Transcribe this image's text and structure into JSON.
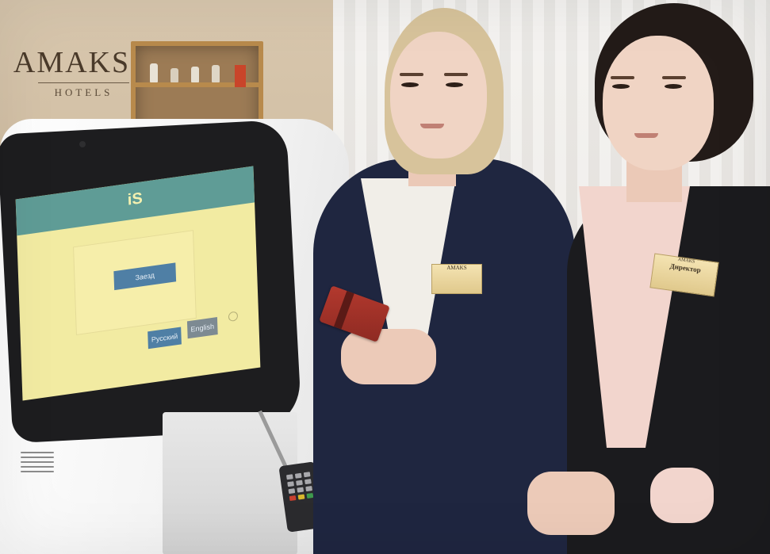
{
  "logo": {
    "name": "AMAKS",
    "sub": "HOTELS"
  },
  "kiosk": {
    "screen_logo": "iS",
    "main_button": "Заезд",
    "lang_button_1": "Русский",
    "lang_button_2": "English"
  },
  "badges": {
    "left": {
      "line1": "AMAKS",
      "line2": ""
    },
    "right": {
      "logo": "AMAKS",
      "title": "Директор",
      "name": ""
    }
  },
  "colors": {
    "kiosk_screen": "#f2eba2",
    "screen_header": "#5f9c96",
    "screen_button": "#4f7fa5",
    "jacket": "#1f2640",
    "card": "#b3392e"
  }
}
